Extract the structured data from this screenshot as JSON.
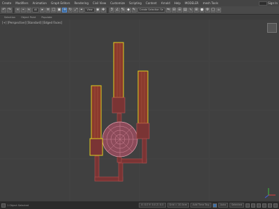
{
  "menu": {
    "items": [
      "Create",
      "Modifiers",
      "Animation",
      "Graph Editors",
      "Rendering",
      "Civil View",
      "Customize",
      "Scripting",
      "Content",
      "Arnold",
      "Help",
      "MODELER",
      "mesh Tools"
    ],
    "signin": "Sign In"
  },
  "toolbar": {
    "filter_dropdown": "All",
    "view_dropdown": "View",
    "selection_set": "Create Selection Se"
  },
  "subbar": {
    "items": [
      "Selection",
      "Object Paint",
      "Populate"
    ]
  },
  "viewport": {
    "label": "[+] [Perspective] [Standard] [Edged Faces]"
  },
  "status": {
    "left": "1 Object Selected",
    "coords": "X: 0.0  Y: 0.0  Z: 0.0",
    "grid": "Grid = 10.0cm",
    "key": "Add Time Tag",
    "auto": "Auto",
    "selected": "Selected"
  },
  "colors": {
    "object_wire": "#8b3a3a",
    "selection_yellow": "#e0d020",
    "accent_blue": "#3b6ea5"
  }
}
